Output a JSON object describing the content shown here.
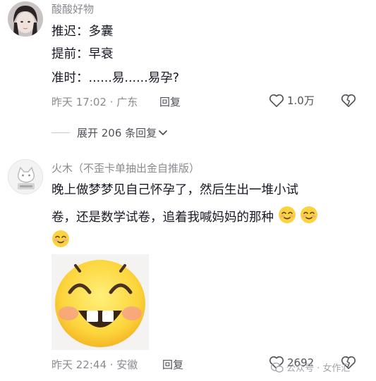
{
  "comments": [
    {
      "username": "酸酸好物",
      "lines": [
        "推迟：多囊",
        "提前：早衰",
        "准时：......易......易孕?"
      ],
      "time_location": "昨天 17:02 · 广东",
      "reply_label": "回复",
      "like_count": "1.0万"
    },
    {
      "username": "火木（不歪卡单抽出金自推版）",
      "lines": [
        "晚上做梦梦见自己怀孕了，然后生出一堆小试",
        "卷，还是数学试卷，追着我喊妈妈的那种"
      ],
      "time_location": "昨天 22:44 · 安徽",
      "reply_label": "回复",
      "like_count": "2692"
    }
  ],
  "expand_replies_label": "展开 206 条回复",
  "watermark": "公众号 · 女作汇",
  "icons": {
    "like": "heart-outline-icon",
    "dislike": "broken-heart-icon",
    "expand": "chevron-down-icon",
    "emoji": "smile-emoji-icon"
  },
  "colors": {
    "text_primary": "#161823",
    "text_secondary": "#8a8b91",
    "emoji_yellow": "#fbd33f"
  }
}
